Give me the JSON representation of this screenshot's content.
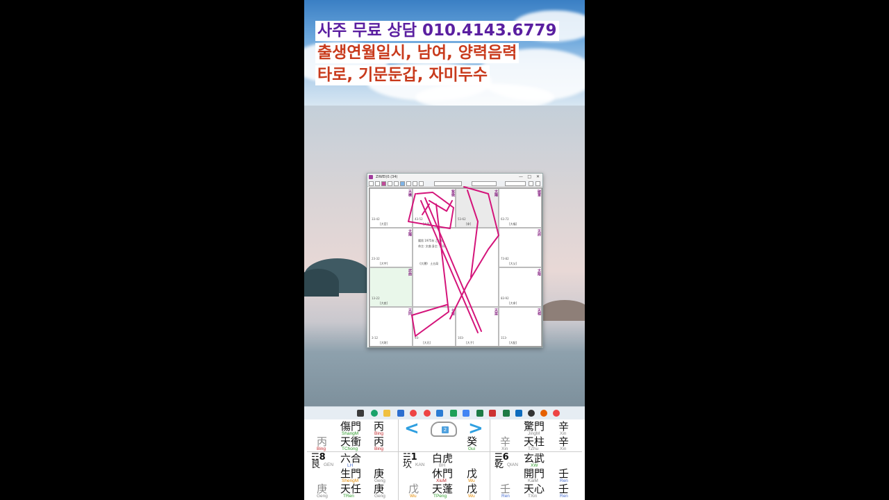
{
  "captions": {
    "line1": "사주 무료 상담 010.4143.6779",
    "line2": "출생연월일시, 남여, 양력음력",
    "line3": "타로, 기문둔갑, 자미두수"
  },
  "window": {
    "title": "ZIWEI(0.(34)",
    "controls": {
      "minimize": "—",
      "maximize": "□",
      "close": "✕"
    }
  },
  "chart_cells": [
    {
      "star": "天機",
      "age": "33-42",
      "label": "[大官]"
    },
    {
      "star": "紫微",
      "age": "43-52",
      "label": "[大田]"
    },
    {
      "star": "太陽",
      "age": "53-62",
      "label": "[命]"
    },
    {
      "star": "破軍",
      "age": "63-72",
      "label": "[大福]"
    },
    {
      "star": "太陽",
      "age": "23-32",
      "label": "[大宇]"
    },
    {
      "star": "天府",
      "age": "73-82",
      "label": "[大父]"
    },
    {
      "star": "武曲",
      "age": "13-22",
      "label": "[大疾]"
    },
    {
      "star": "太陰",
      "age": "83-92",
      "label": "[大命]"
    },
    {
      "star": "天同",
      "age": "3-12",
      "label": "[大財]"
    },
    {
      "star": "七殺",
      "age": "93-",
      "label": "[大兄]"
    },
    {
      "star": "天梁",
      "age": "103-",
      "label": "[大子]"
    },
    {
      "star": "天相",
      "age": "113-",
      "label": "[大配]"
    }
  ],
  "center_text": {
    "line1": "陽男 1975年 乙卯年",
    "line2": "命主: 文曲  身主: 天同",
    "line3": "《大運》 土五局"
  },
  "qimen": {
    "left": {
      "top_big": "傷門",
      "top_big_pinyin": "ShangM",
      "top_stem": "丙",
      "top_stem_pinyin": "Bing",
      "mid_left": "丙",
      "mid_left_pinyin": "Bing",
      "mid_big": "天衝",
      "mid_big_pinyin": "TChong",
      "mid_stem": "丙",
      "mid_stem_pinyin": "Bing",
      "trigram": "☶8",
      "trigram_name": "艮",
      "trigram_pinyin": "GEN",
      "deity": "六合",
      "deity_pinyin": "LH",
      "gate": "生門",
      "gate_pinyin": "ShengM",
      "gate_stem": "庚",
      "gate_stem_pinyin": "Geng",
      "bot_left": "庚",
      "bot_left_pinyin": "Geng",
      "bot_big": "天任",
      "bot_big_pinyin": "TRen",
      "bot_stem": "庚",
      "bot_stem_pinyin": "Geng"
    },
    "center": {
      "nav_left": "<",
      "nav_right": ">",
      "nav_num": "2",
      "mid_stem": "癸",
      "mid_stem_pinyin": "Gui",
      "trigram": "☵1",
      "trigram_name": "坎",
      "trigram_pinyin": "KAN",
      "deity": "白虎",
      "deity_pinyin": "BH",
      "gate": "休門",
      "gate_pinyin": "XiuM",
      "gate_stem": "戊",
      "gate_stem_pinyin": "Wu",
      "bot_left": "戊",
      "bot_left_pinyin": "Wu",
      "bot_big": "天蓬",
      "bot_big_pinyin": "TPeng",
      "bot_stem": "戊",
      "bot_stem_pinyin": "Wu"
    },
    "right": {
      "top_big": "驚門",
      "top_big_pinyin": "JingM",
      "top_stem": "辛",
      "top_stem_pinyin": "Xin",
      "mid_left": "辛",
      "mid_left_pinyin": "Xin",
      "mid_big": "天柱",
      "mid_big_pinyin": "TZhu",
      "mid_stem": "辛",
      "mid_stem_pinyin": "Xin",
      "trigram": "☰6",
      "trigram_name": "乾",
      "trigram_pinyin": "QIAN",
      "deity": "玄武",
      "deity_pinyin": "XW",
      "gate": "開門",
      "gate_pinyin": "KaiM",
      "gate_stem": "壬",
      "gate_stem_pinyin": "Ren",
      "bot_left": "壬",
      "bot_left_pinyin": "Ren",
      "bot_big": "天心",
      "bot_big_pinyin": "TXin",
      "bot_stem": "壬",
      "bot_stem_pinyin": "Ren"
    }
  },
  "colors": {
    "caption_purple": "#5a1fa0",
    "caption_red": "#c83a1c",
    "scribble": "#d4147a",
    "nav_blue": "#2f9fe0"
  }
}
